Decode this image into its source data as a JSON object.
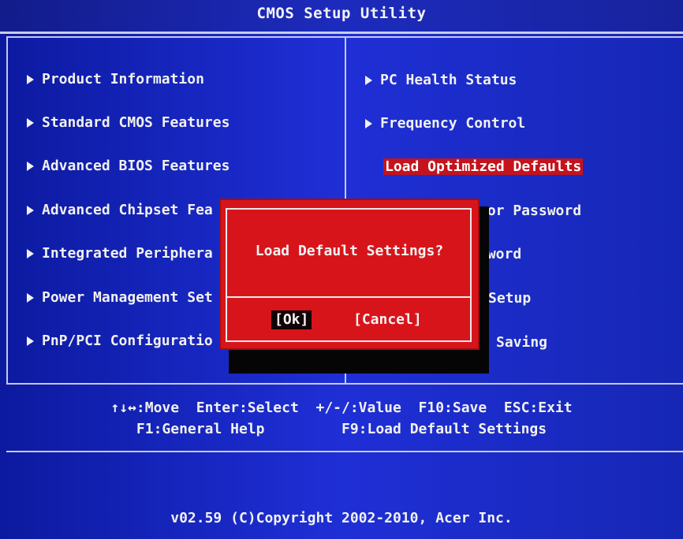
{
  "title": "CMOS Setup Utility",
  "left_menu": [
    {
      "label": "Product Information"
    },
    {
      "label": "Standard CMOS Features"
    },
    {
      "label": "Advanced BIOS Features"
    },
    {
      "label": "Advanced Chipset Fea"
    },
    {
      "label": "Integrated Periphera"
    },
    {
      "label": "Power Management Set"
    },
    {
      "label": "PnP/PCI Configuratio"
    }
  ],
  "right_menu": [
    {
      "label": "PC Health Status",
      "arrow": true
    },
    {
      "label": "Frequency Control",
      "arrow": true
    },
    {
      "label": "Load Optimized Defaults",
      "arrow": false,
      "selected": true
    },
    {
      "label": "sor Password",
      "arrow": false
    },
    {
      "label": "sword",
      "arrow": false
    },
    {
      "label": "Setup",
      "arrow": false
    },
    {
      "label": "Saving",
      "arrow": false
    }
  ],
  "dialog": {
    "message": "Load Default Settings?",
    "ok_label": "[Ok]",
    "cancel_label": "[Cancel]"
  },
  "help": {
    "line1": "↑↓↔:Move  Enter:Select  +/-/:Value  F10:Save  ESC:Exit",
    "line2": "F1:General Help         F9:Load Default Settings"
  },
  "footer": "v02.59 (C)Copyright 2002-2010, Acer Inc.",
  "colors": {
    "background": "#1f2fd6",
    "highlight": "#c4131c",
    "dialog": "#d8141b",
    "text": "#f1f1ef"
  }
}
